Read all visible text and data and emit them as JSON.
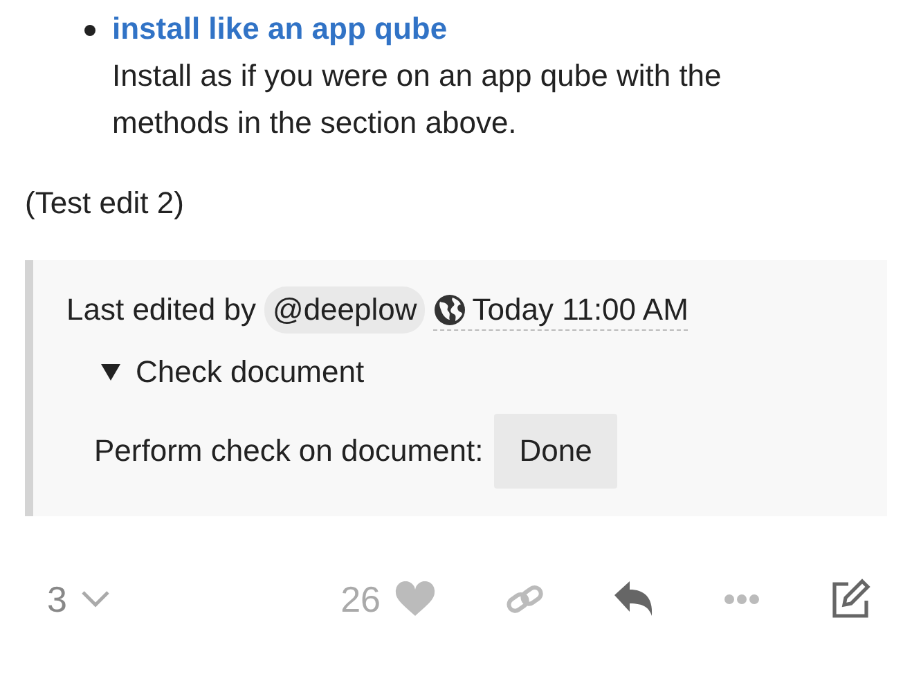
{
  "list": [
    {
      "title": "install like an app qube",
      "description": "Install as if you were on an app qube with the methods in the section above."
    }
  ],
  "paragraph": "(Test edit 2)",
  "edit_notice": {
    "prefix": "Last edited by",
    "user": "@deeplow",
    "date": "Today 11:00 AM",
    "details": {
      "expanded": true,
      "summary": "Check document",
      "label": "Perform check on document:",
      "button": "Done"
    }
  },
  "actions": {
    "replies": "3",
    "likes": "26"
  }
}
